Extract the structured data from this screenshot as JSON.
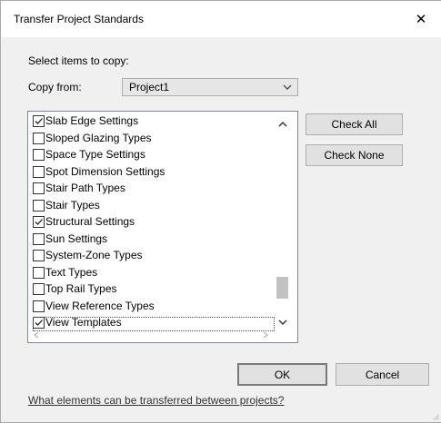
{
  "window": {
    "title": "Transfer Project Standards",
    "close_glyph": "✕"
  },
  "select_label": "Select items to copy:",
  "copy_from": {
    "label": "Copy from:",
    "value": "Project1"
  },
  "items": [
    {
      "label": "Slab Edge Settings",
      "checked": true
    },
    {
      "label": "Sloped Glazing Types",
      "checked": false
    },
    {
      "label": "Space Type Settings",
      "checked": false
    },
    {
      "label": "Spot Dimension Settings",
      "checked": false
    },
    {
      "label": "Stair Path Types",
      "checked": false
    },
    {
      "label": "Stair Types",
      "checked": false
    },
    {
      "label": "Structural Settings",
      "checked": true
    },
    {
      "label": "Sun Settings",
      "checked": false
    },
    {
      "label": "System-Zone Types",
      "checked": false
    },
    {
      "label": "Text Types",
      "checked": false
    },
    {
      "label": "Top Rail Types",
      "checked": false
    },
    {
      "label": "View Reference Types",
      "checked": false
    },
    {
      "label": "View Templates",
      "checked": true
    }
  ],
  "buttons": {
    "check_all": "Check All",
    "check_none": "Check None",
    "ok": "OK",
    "cancel": "Cancel"
  },
  "help_link": "What elements can be transferred between projects?",
  "icons": {
    "close": "close-icon",
    "dropdown": "chevron-down-icon",
    "check": "checkmark-icon"
  }
}
